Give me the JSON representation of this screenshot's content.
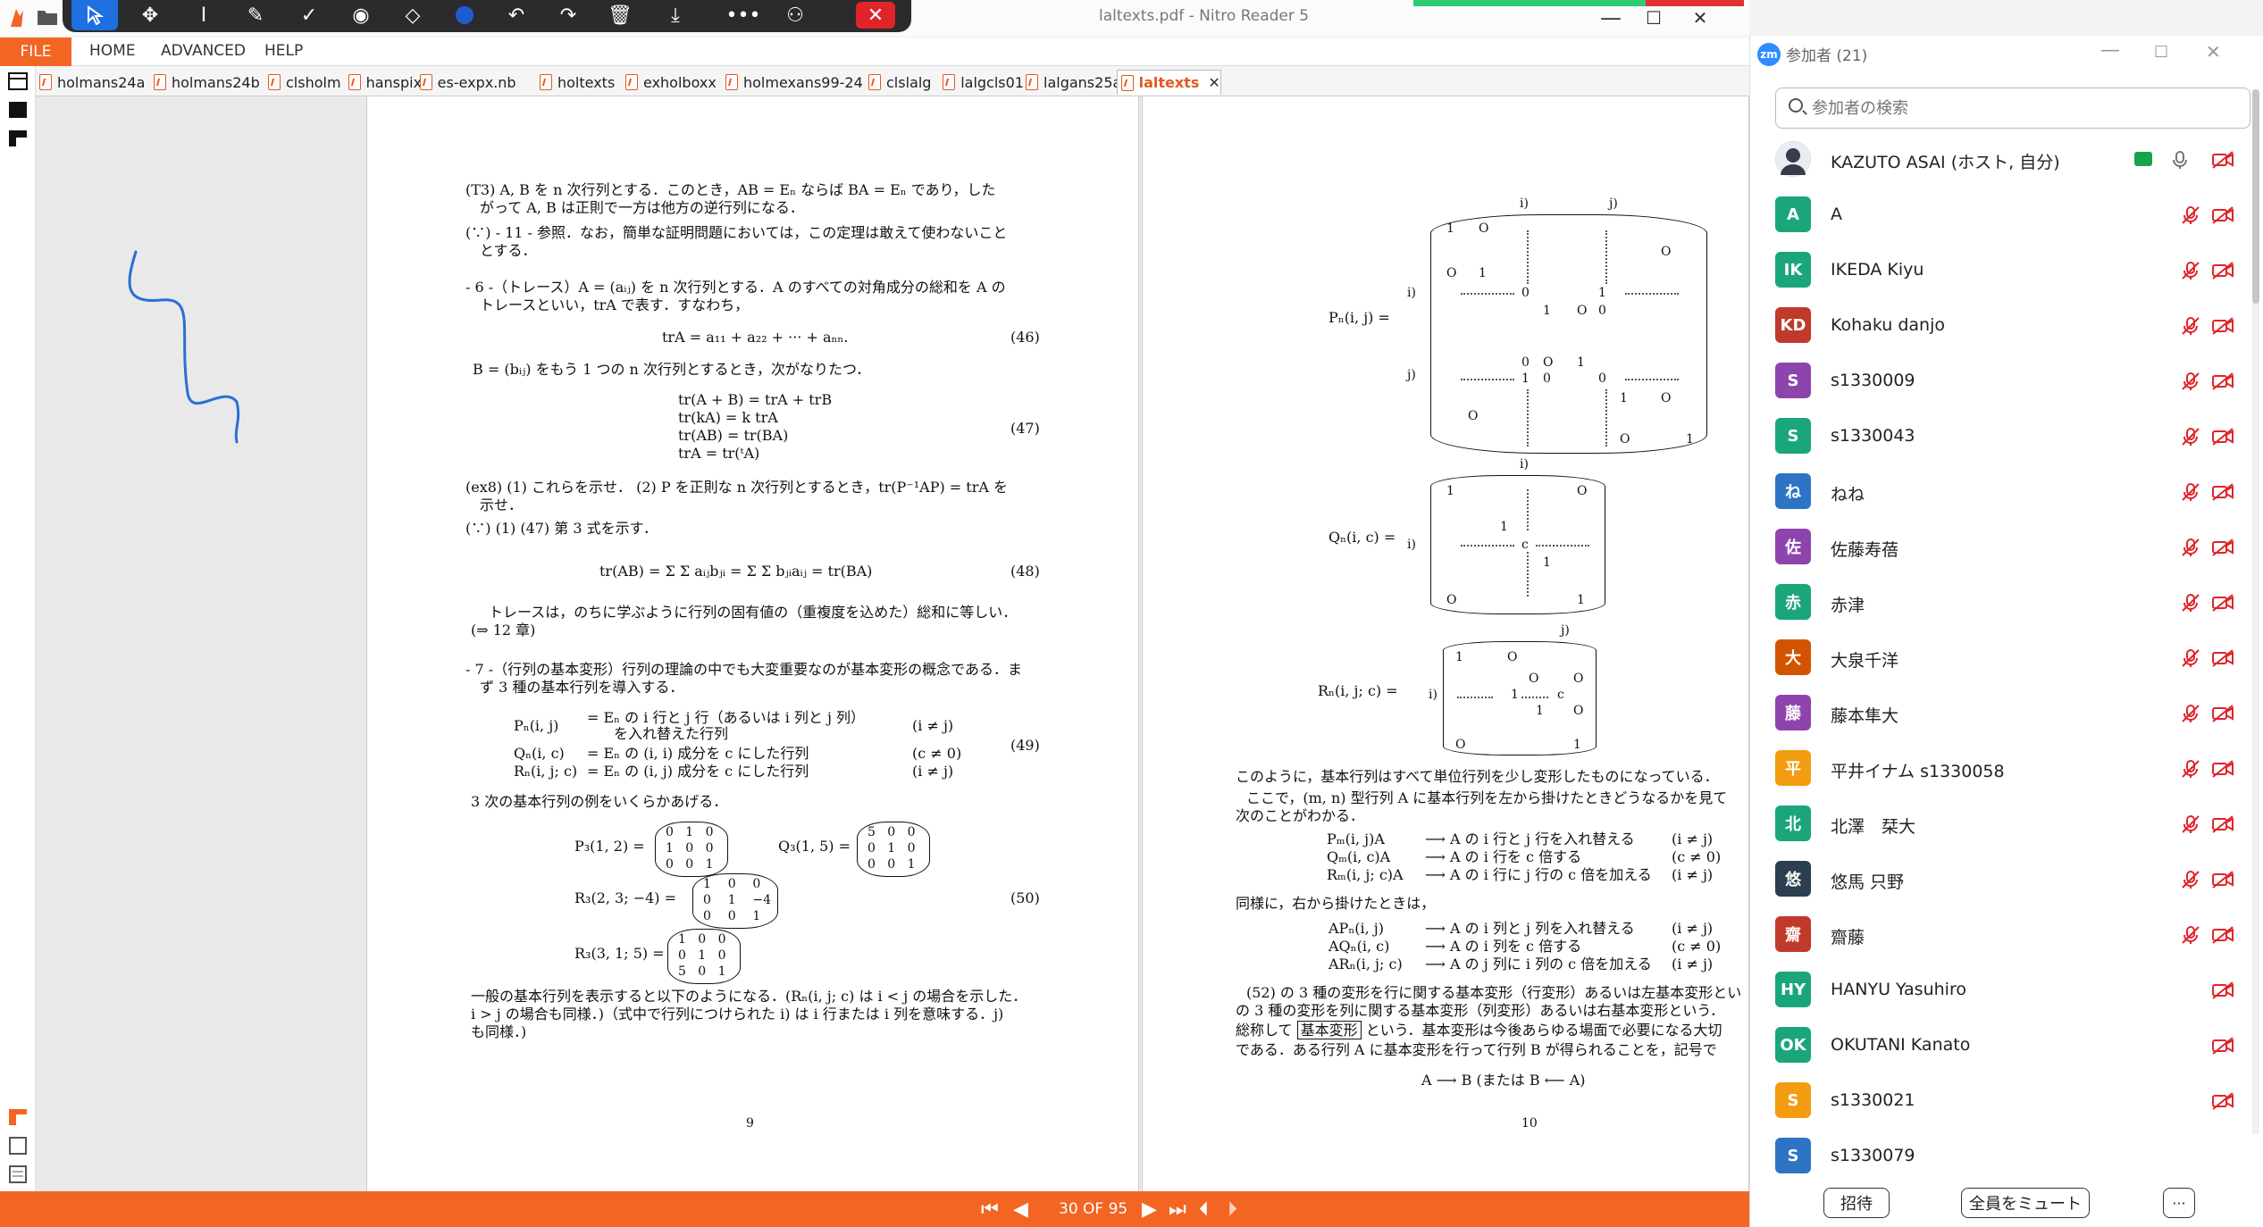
{
  "window": {
    "title": "laltexts.pdf - Nitro Reader 5",
    "minimize": "—",
    "maximize": "☐",
    "close": "✕"
  },
  "ribbon": {
    "file": "FILE",
    "home": "HOME",
    "advanced": "ADVANCED",
    "help": "HELP"
  },
  "doc_tabs": [
    "holmans24a",
    "holmans24b",
    "clsholm",
    "hanspix",
    "es-expx.nb",
    "holtexts",
    "exholboxx",
    "holmexans99-24",
    "clslalg",
    "lalgcls01",
    "lalgans25a",
    "laltexts"
  ],
  "active_tab_close": "✕",
  "page9": {
    "t3_a": "(T3)  A, B を n 次行列とする．このとき，AB = Eₙ ならば BA = Eₙ であり，した",
    "t3_b": "がって A, B は正則で一方は他方の逆行列になる．",
    "t3_c": "(∵) - 11 - 参照．なお，簡単な証明問題においては，この定理は敢えて使わないこと",
    "t3_d": "とする．",
    "s6_a": "- 6 -（トレース）A = (aᵢⱼ) を n 次行列とする．A のすべての対角成分の総和を A の",
    "s6_b": "トレースといい，trA で表す．すなわち，",
    "eq46": "trA = a₁₁ + a₂₂ + ··· + aₙₙ.",
    "eq46_no": "(46)",
    "b_def": "B = (bᵢⱼ) をもう 1 つの n 次行列とするとき，次がなりたつ．",
    "eq47_1": "tr(A + B) = trA + trB",
    "eq47_2": "tr(kA) = k trA",
    "eq47_3": "tr(AB) = tr(BA)",
    "eq47_4": "trA = tr(ᵗA)",
    "eq47_no": "(47)",
    "ex8_a": "(ex8)  (1) これらを示せ．  (2) P を正則な n 次行列とするとき，tr(P⁻¹AP) = trA を",
    "ex8_b": "示せ．",
    "proof": "(∵)  (1)  (47) 第 3 式を示す．",
    "eq48": "tr(AB) = Σ Σ aᵢⱼbⱼᵢ = Σ Σ bⱼᵢaᵢⱼ = tr(BA)",
    "eq48_no": "(48)",
    "trace_a": "トレースは，のちに学ぶように行列の固有値の（重複度を込めた）総和に等しい．",
    "trace_b": "(⇒ 12 章)",
    "s7_a": "- 7 -（行列の基本変形）行列の理論の中でも大変重要なのが基本変形の概念である．ま",
    "s7_b": "ず 3 種の基本行列を導入する．",
    "eq49_p": "Pₙ(i, j)",
    "eq49_p_def1": "=  Eₙ の i 行と j 行（あるいは i 列と j 列）",
    "eq49_p_def2": "を入れ替えた行列",
    "eq49_p_cond": "(i ≠ j)",
    "eq49_q": "Qₙ(i, c)",
    "eq49_q_def": "= Eₙ の (i, i) 成分を c にした行列",
    "eq49_q_cond": "(c ≠ 0)",
    "eq49_r": "Rₙ(i, j; c)",
    "eq49_r_def": "= Eₙ の (i, j) 成分を c にした行列",
    "eq49_r_cond": "(i ≠ j)",
    "eq49_no": "(49)",
    "examples": "3 次の基本行列の例をいくらかあげる．",
    "ex_p3": "P₃(1, 2) =",
    "ex_q3": "Q₃(1, 5) =",
    "ex_r3a": "R₃(2, 3; −4) =",
    "ex_r3b": "R₃(3, 1; 5) =",
    "eq50_no": "(50)",
    "mat_p3": [
      [
        "0",
        "1",
        "0"
      ],
      [
        "1",
        "0",
        "0"
      ],
      [
        "0",
        "0",
        "1"
      ]
    ],
    "mat_q3": [
      [
        "5",
        "0",
        "0"
      ],
      [
        "0",
        "1",
        "0"
      ],
      [
        "0",
        "0",
        "1"
      ]
    ],
    "mat_r3a": [
      [
        "1",
        "0",
        "0"
      ],
      [
        "0",
        "1",
        "−4"
      ],
      [
        "0",
        "0",
        "1"
      ]
    ],
    "mat_r3b": [
      [
        "1",
        "0",
        "0"
      ],
      [
        "0",
        "1",
        "0"
      ],
      [
        "5",
        "0",
        "1"
      ]
    ],
    "gen_a": "一般の基本行列を表示すると以下のようになる．(Rₙ(i, j; c) は i < j の場合を示した．",
    "gen_b": "i > j の場合も同様．)（式中で行列につけられた i) は i 行または i 列を意味する．j)",
    "gen_c": "も同様．)",
    "page_number": "9"
  },
  "page10": {
    "pn_label": "Pₙ(i, j) =",
    "qn_label": "Qₙ(i, c) =",
    "rn_label": "Rₙ(i, j; c) =",
    "mark_i": "i)",
    "mark_j": "j)",
    "one": "1",
    "zero": "0",
    "big_o": "O",
    "c": "c",
    "p1": "このように，基本行列はすべて単位行列を少し変形したものになっている．",
    "p2a": "ここで，(m, n) 型行列 A に基本行列を左から掛けたときどうなるかを見て",
    "p2b": "次のことがわかる．",
    "l1": "Pₘ(i, j)A",
    "l1d": "⟶ A の i 行と j 行を入れ替える",
    "l1c": "(i ≠ j)",
    "l2": "Qₘ(i, c)A",
    "l2d": "⟶ A の i 行を c 倍する",
    "l2c": "(c ≠ 0)",
    "l3": "Rₘ(i, j; c)A",
    "l3d": "⟶ A の i 行に j 行の c 倍を加える",
    "l3c": "(i ≠ j)",
    "right": "同様に，右から掛けたときは，",
    "r1": "APₙ(i, j)",
    "r1d": "⟶ A の i 列と j 列を入れ替える",
    "r1c": "(i ≠ j)",
    "r2": "AQₙ(i, c)",
    "r2d": "⟶ A の i 列を c 倍する",
    "r2c": "(c ≠ 0)",
    "r3": "ARₙ(i, j; c)",
    "r3d": "⟶ A の j 列に i 列の c 倍を加える",
    "r3c": "(i ≠ j)",
    "p3a": "(52) の 3 種の変形を行に関する基本変形（行変形）あるいは左基本変形とい",
    "p3b": "の 3 種の変形を列に関する基本変形（列変形）あるいは右基本変形という．",
    "p3c_pre": "総称して",
    "p3c_box": "基本変形",
    "p3c_post": "という．基本変形は今後あらゆる場面で必要になる大切",
    "p3d": "である．ある行列 A に基本変形を行って行列 B が得られることを，記号で",
    "arrow_eq": "A ⟶ B     (または B ⟵ A)",
    "page_number": "10"
  },
  "navbar": {
    "page_counter": "30 OF 95"
  },
  "zoom": {
    "logo": "zm",
    "title": "参加者 (21)",
    "search_placeholder": "参加者の検索",
    "participants": [
      {
        "name": "KAZUTO ASAI (ホスト, 自分)",
        "initials": "",
        "color": "#5a6b8a"
      },
      {
        "name": "A",
        "initials": "A",
        "color": "#1aa67a"
      },
      {
        "name": "IKEDA Kiyu",
        "initials": "IK",
        "color": "#1aa67a"
      },
      {
        "name": "Kohaku danjo",
        "initials": "KD",
        "color": "#c0392b"
      },
      {
        "name": "s1330009",
        "initials": "S",
        "color": "#8e44ad"
      },
      {
        "name": "s1330043",
        "initials": "S",
        "color": "#1aa67a"
      },
      {
        "name": "ねね",
        "initials": "ね",
        "color": "#2d74c4"
      },
      {
        "name": "佐藤寿蓓",
        "initials": "佐",
        "color": "#8e44ad"
      },
      {
        "name": "赤津",
        "initials": "赤",
        "color": "#1aa67a"
      },
      {
        "name": "大泉千洋",
        "initials": "大",
        "color": "#d35400"
      },
      {
        "name": "藤本隼大",
        "initials": "藤",
        "color": "#8e44ad"
      },
      {
        "name": "平井イナム s1330058",
        "initials": "平",
        "color": "#f39c12"
      },
      {
        "name": "北澤　栞大",
        "initials": "北",
        "color": "#1aa67a"
      },
      {
        "name": "悠馬 只野",
        "initials": "悠",
        "color": "#2c3e50"
      },
      {
        "name": "齋藤",
        "initials": "齋",
        "color": "#c0392b"
      },
      {
        "name": "HANYU Yasuhiro",
        "initials": "HY",
        "color": "#1aa67a"
      },
      {
        "name": "OKUTANI Kanato",
        "initials": "OK",
        "color": "#1aa67a"
      },
      {
        "name": "s1330021",
        "initials": "S",
        "color": "#f39c12"
      },
      {
        "name": "s1330079",
        "initials": "S",
        "color": "#2d74c4"
      }
    ],
    "invite": "招待",
    "mute_all": "全員をミュート",
    "more": "···",
    "minimize": "—",
    "popout": "☐",
    "close": "✕"
  },
  "colors": {
    "accent": "#f26522",
    "mute_red": "#e0242a",
    "ink": "#2a6fd6"
  }
}
